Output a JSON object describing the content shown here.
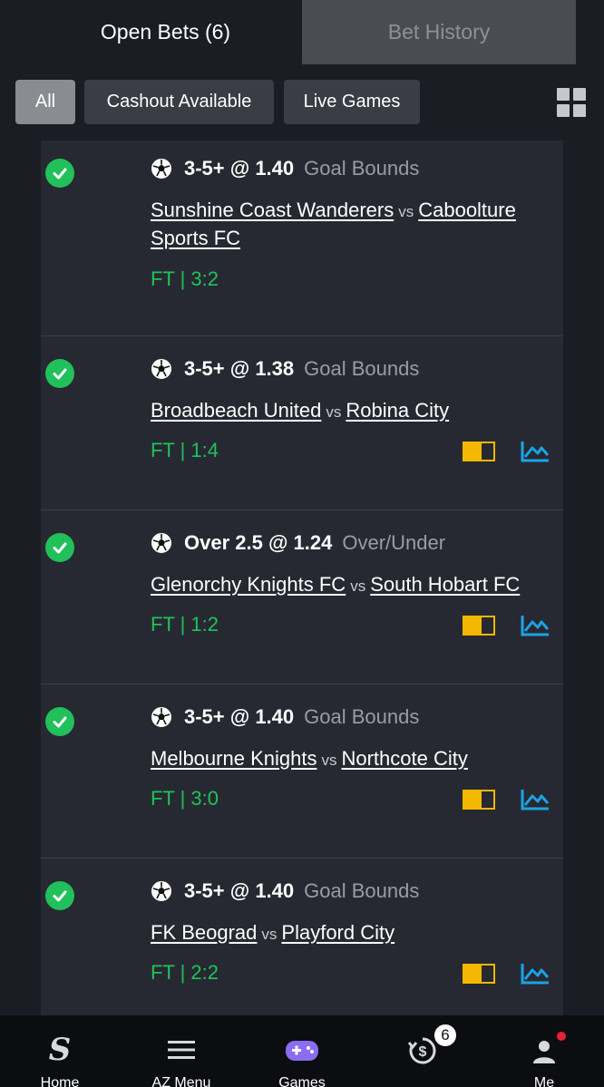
{
  "tabs": {
    "open_bets": "Open Bets (6)",
    "bet_history": "Bet History"
  },
  "filters": {
    "all": "All",
    "cashout": "Cashout Available",
    "live": "Live Games"
  },
  "bets": [
    {
      "selection": "3-5+ @ 1.40",
      "market": "Goal Bounds",
      "home": "Sunshine Coast Wanderers",
      "vs": "vs",
      "away": "Caboolture Sports FC",
      "score": "FT | 3:2",
      "has_media": false
    },
    {
      "selection": "3-5+ @ 1.38",
      "market": "Goal Bounds",
      "home": "Broadbeach United",
      "vs": "vs",
      "away": "Robina City",
      "score": "FT | 1:4",
      "has_media": true
    },
    {
      "selection": "Over 2.5 @ 1.24",
      "market": "Over/Under",
      "home": "Glenorchy Knights FC",
      "vs": "vs",
      "away": "South Hobart FC",
      "score": "FT | 1:2",
      "has_media": true
    },
    {
      "selection": "3-5+ @ 1.40",
      "market": "Goal Bounds",
      "home": "Melbourne Knights",
      "vs": "vs",
      "away": "Northcote City",
      "score": "FT | 3:0",
      "has_media": true
    },
    {
      "selection": "3-5+ @ 1.40",
      "market": "Goal Bounds",
      "home": "FK Beograd",
      "vs": "vs",
      "away": "Playford City",
      "score": "FT | 2:2",
      "has_media": true
    }
  ],
  "nav": {
    "home": "Home",
    "az_menu": "AZ Menu",
    "games": "Games",
    "me": "Me",
    "cashout_badge": "6"
  },
  "colors": {
    "accent_green": "#1fc25a",
    "check_green": "#21c05a",
    "live_yellow": "#f5b800",
    "stats_blue": "#1aa3e8",
    "games_purple": "#8c6cf0"
  }
}
